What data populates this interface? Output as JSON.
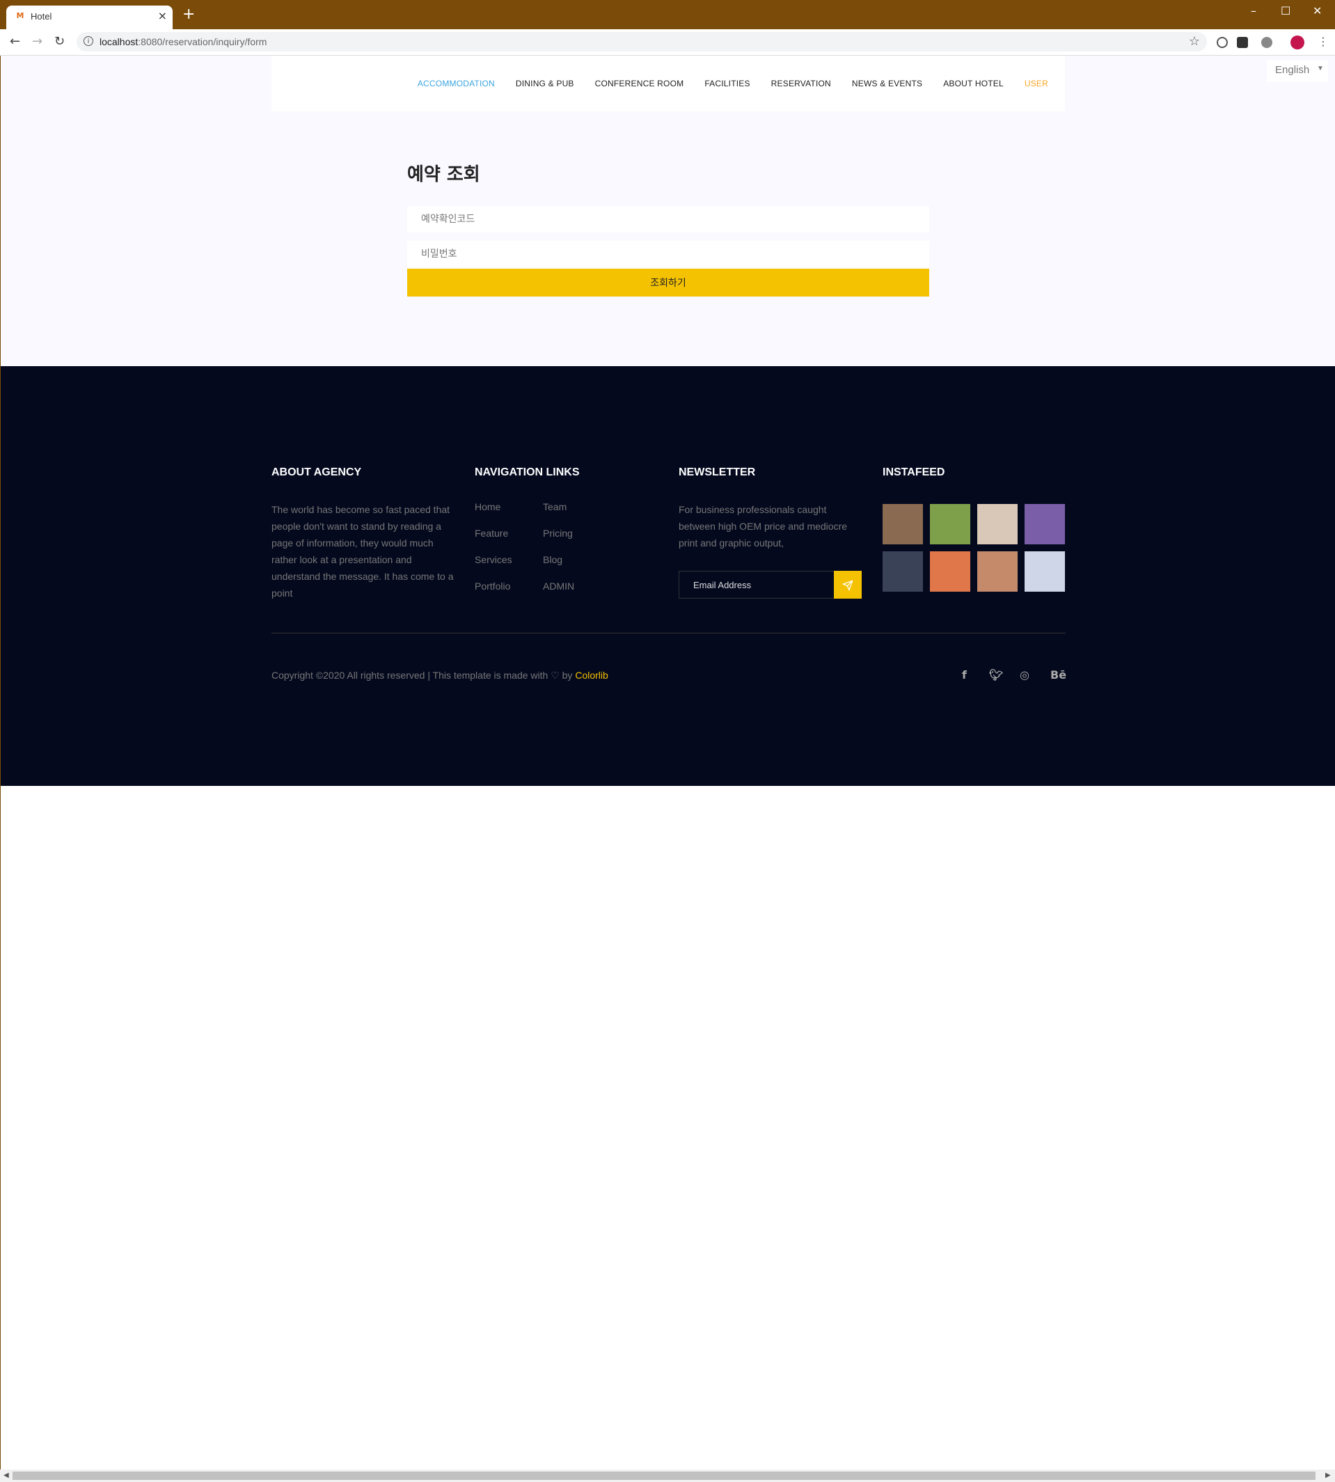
{
  "browser": {
    "tab_title": "Hotel",
    "url_host": "localhost",
    "url_rest": ":8080/reservation/inquiry/form"
  },
  "header": {
    "menu": [
      {
        "label": "ACCOMMODATION"
      },
      {
        "label": "DINING & PUB"
      },
      {
        "label": "CONFERENCE ROOM"
      },
      {
        "label": "FACILITIES"
      },
      {
        "label": "RESERVATION"
      },
      {
        "label": "NEWS & EVENTS"
      },
      {
        "label": "ABOUT HOTEL"
      },
      {
        "label": "USER"
      }
    ],
    "language": "English",
    "colors": {
      "active": "#3ca4df",
      "user": "#f5a623"
    }
  },
  "form": {
    "title": "예약 조회",
    "code_placeholder": "예약확인코드",
    "password_placeholder": "비밀번호",
    "submit_label": "조회하기",
    "button_color": "#f4c200"
  },
  "footer": {
    "about": {
      "title": "ABOUT AGENCY",
      "text": "The world has become so fast paced that people don't want to stand by reading a page of information, they would much rather look at a presentation and understand the message. It has come to a point"
    },
    "navigation": {
      "title": "NAVIGATION LINKS",
      "col1": [
        "Home",
        "Feature",
        "Services",
        "Portfolio"
      ],
      "col2": [
        "Team",
        "Pricing",
        "Blog",
        "ADMIN"
      ]
    },
    "newsletter": {
      "title": "NEWSLETTER",
      "text": "For business professionals caught between high OEM price and mediocre print and graphic output,",
      "email_placeholder": "Email Address",
      "send_icon": "paper-plane-icon"
    },
    "instafeed": {
      "title": "INSTAFEED",
      "thumbs": [
        "#8a6a50",
        "#7fa04a",
        "#d9c7b8",
        "#7a5fa8",
        "#3a4258",
        "#e0774a",
        "#c58a6a",
        "#cfd6e8"
      ]
    },
    "copyright_prefix": "Copyright ©2020 All rights reserved | This template is made with ♡ by ",
    "copyright_brand": "Colorlib",
    "social": [
      "facebook-icon",
      "twitter-icon",
      "dribbble-icon",
      "behance-icon"
    ],
    "background": "#04091e"
  }
}
